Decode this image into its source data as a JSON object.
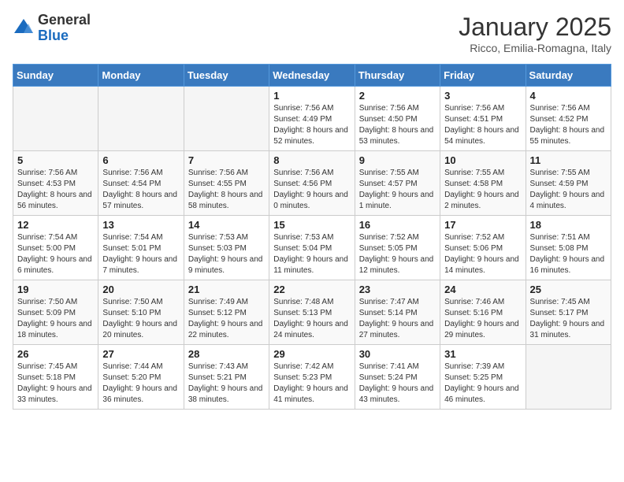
{
  "header": {
    "logo_general": "General",
    "logo_blue": "Blue",
    "month_title": "January 2025",
    "location": "Ricco, Emilia-Romagna, Italy"
  },
  "weekdays": [
    "Sunday",
    "Monday",
    "Tuesday",
    "Wednesday",
    "Thursday",
    "Friday",
    "Saturday"
  ],
  "weeks": [
    [
      {
        "day": "",
        "info": ""
      },
      {
        "day": "",
        "info": ""
      },
      {
        "day": "",
        "info": ""
      },
      {
        "day": "1",
        "info": "Sunrise: 7:56 AM\nSunset: 4:49 PM\nDaylight: 8 hours and 52 minutes."
      },
      {
        "day": "2",
        "info": "Sunrise: 7:56 AM\nSunset: 4:50 PM\nDaylight: 8 hours and 53 minutes."
      },
      {
        "day": "3",
        "info": "Sunrise: 7:56 AM\nSunset: 4:51 PM\nDaylight: 8 hours and 54 minutes."
      },
      {
        "day": "4",
        "info": "Sunrise: 7:56 AM\nSunset: 4:52 PM\nDaylight: 8 hours and 55 minutes."
      }
    ],
    [
      {
        "day": "5",
        "info": "Sunrise: 7:56 AM\nSunset: 4:53 PM\nDaylight: 8 hours and 56 minutes."
      },
      {
        "day": "6",
        "info": "Sunrise: 7:56 AM\nSunset: 4:54 PM\nDaylight: 8 hours and 57 minutes."
      },
      {
        "day": "7",
        "info": "Sunrise: 7:56 AM\nSunset: 4:55 PM\nDaylight: 8 hours and 58 minutes."
      },
      {
        "day": "8",
        "info": "Sunrise: 7:56 AM\nSunset: 4:56 PM\nDaylight: 9 hours and 0 minutes."
      },
      {
        "day": "9",
        "info": "Sunrise: 7:55 AM\nSunset: 4:57 PM\nDaylight: 9 hours and 1 minute."
      },
      {
        "day": "10",
        "info": "Sunrise: 7:55 AM\nSunset: 4:58 PM\nDaylight: 9 hours and 2 minutes."
      },
      {
        "day": "11",
        "info": "Sunrise: 7:55 AM\nSunset: 4:59 PM\nDaylight: 9 hours and 4 minutes."
      }
    ],
    [
      {
        "day": "12",
        "info": "Sunrise: 7:54 AM\nSunset: 5:00 PM\nDaylight: 9 hours and 6 minutes."
      },
      {
        "day": "13",
        "info": "Sunrise: 7:54 AM\nSunset: 5:01 PM\nDaylight: 9 hours and 7 minutes."
      },
      {
        "day": "14",
        "info": "Sunrise: 7:53 AM\nSunset: 5:03 PM\nDaylight: 9 hours and 9 minutes."
      },
      {
        "day": "15",
        "info": "Sunrise: 7:53 AM\nSunset: 5:04 PM\nDaylight: 9 hours and 11 minutes."
      },
      {
        "day": "16",
        "info": "Sunrise: 7:52 AM\nSunset: 5:05 PM\nDaylight: 9 hours and 12 minutes."
      },
      {
        "day": "17",
        "info": "Sunrise: 7:52 AM\nSunset: 5:06 PM\nDaylight: 9 hours and 14 minutes."
      },
      {
        "day": "18",
        "info": "Sunrise: 7:51 AM\nSunset: 5:08 PM\nDaylight: 9 hours and 16 minutes."
      }
    ],
    [
      {
        "day": "19",
        "info": "Sunrise: 7:50 AM\nSunset: 5:09 PM\nDaylight: 9 hours and 18 minutes."
      },
      {
        "day": "20",
        "info": "Sunrise: 7:50 AM\nSunset: 5:10 PM\nDaylight: 9 hours and 20 minutes."
      },
      {
        "day": "21",
        "info": "Sunrise: 7:49 AM\nSunset: 5:12 PM\nDaylight: 9 hours and 22 minutes."
      },
      {
        "day": "22",
        "info": "Sunrise: 7:48 AM\nSunset: 5:13 PM\nDaylight: 9 hours and 24 minutes."
      },
      {
        "day": "23",
        "info": "Sunrise: 7:47 AM\nSunset: 5:14 PM\nDaylight: 9 hours and 27 minutes."
      },
      {
        "day": "24",
        "info": "Sunrise: 7:46 AM\nSunset: 5:16 PM\nDaylight: 9 hours and 29 minutes."
      },
      {
        "day": "25",
        "info": "Sunrise: 7:45 AM\nSunset: 5:17 PM\nDaylight: 9 hours and 31 minutes."
      }
    ],
    [
      {
        "day": "26",
        "info": "Sunrise: 7:45 AM\nSunset: 5:18 PM\nDaylight: 9 hours and 33 minutes."
      },
      {
        "day": "27",
        "info": "Sunrise: 7:44 AM\nSunset: 5:20 PM\nDaylight: 9 hours and 36 minutes."
      },
      {
        "day": "28",
        "info": "Sunrise: 7:43 AM\nSunset: 5:21 PM\nDaylight: 9 hours and 38 minutes."
      },
      {
        "day": "29",
        "info": "Sunrise: 7:42 AM\nSunset: 5:23 PM\nDaylight: 9 hours and 41 minutes."
      },
      {
        "day": "30",
        "info": "Sunrise: 7:41 AM\nSunset: 5:24 PM\nDaylight: 9 hours and 43 minutes."
      },
      {
        "day": "31",
        "info": "Sunrise: 7:39 AM\nSunset: 5:25 PM\nDaylight: 9 hours and 46 minutes."
      },
      {
        "day": "",
        "info": ""
      }
    ]
  ]
}
